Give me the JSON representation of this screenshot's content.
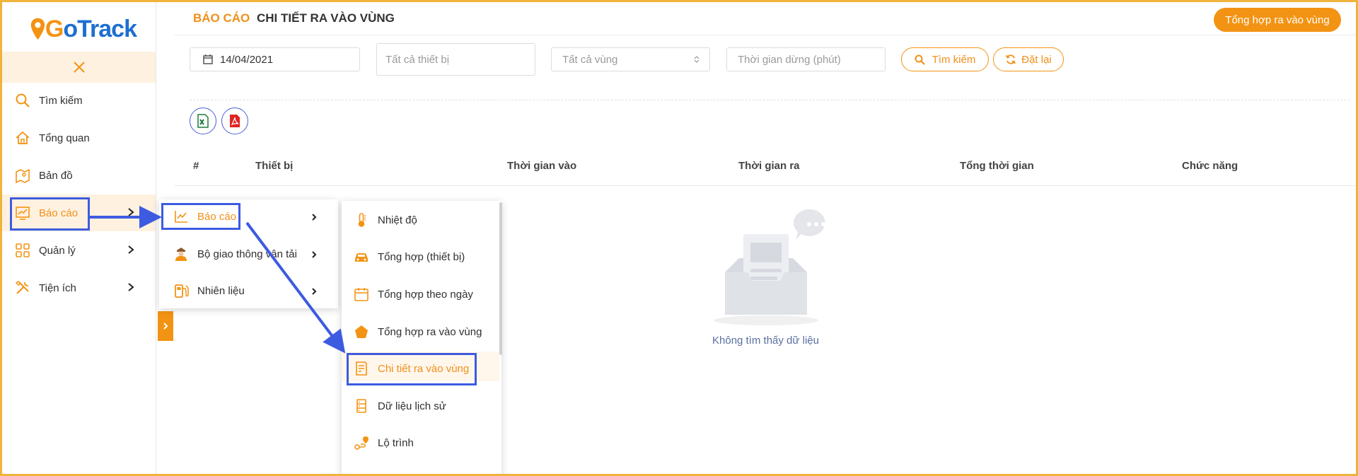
{
  "sidebar": {
    "logo": {
      "g": "G",
      "rest": "oTrack"
    },
    "items": [
      {
        "label": "Tìm kiếm",
        "icon": "search-icon"
      },
      {
        "label": "Tổng quan",
        "icon": "home-icon"
      },
      {
        "label": "Bản đồ",
        "icon": "map-icon"
      },
      {
        "label": "Báo cáo",
        "icon": "chart-icon"
      },
      {
        "label": "Quản lý",
        "icon": "grid-icon"
      },
      {
        "label": "Tiện ích",
        "icon": "tools-icon"
      }
    ]
  },
  "header": {
    "breadcrumb_section": "BÁO CÁO",
    "breadcrumb_page": "CHI TIẾT RA VÀO VÙNG",
    "summary_button": "Tổng hợp ra vào vùng"
  },
  "filters": {
    "date": "14/04/2021",
    "device_placeholder": "Tất cả thiết bị",
    "zone_placeholder": "Tất cả vùng",
    "stop_time_placeholder": "Thời gian dừng (phút)",
    "search_button": "Tìm kiếm",
    "reset_button": "Đặt lại"
  },
  "table": {
    "columns": [
      "#",
      "Thiết bị",
      "Thời gian vào",
      "Thời gian ra",
      "Tổng thời gian",
      "Chức năng"
    ],
    "empty_text": "Không tìm thấy dữ liệu"
  },
  "report_menu": {
    "items": [
      {
        "label": "Báo cáo"
      },
      {
        "label": "Bộ giao thông vận tải"
      },
      {
        "label": "Nhiên liệu"
      }
    ]
  },
  "report_submenu": {
    "items": [
      {
        "label": "Nhiệt độ"
      },
      {
        "label": "Tổng hợp (thiết bị)"
      },
      {
        "label": "Tổng hợp theo ngày"
      },
      {
        "label": "Tổng hợp ra vào vùng"
      },
      {
        "label": "Chi tiết ra vào vùng"
      },
      {
        "label": "Dữ liệu lịch sử"
      },
      {
        "label": "Lộ trình"
      }
    ]
  },
  "colors": {
    "accent": "#f39313",
    "highlight": "#3d5be0",
    "frame": "#f0b43c"
  }
}
